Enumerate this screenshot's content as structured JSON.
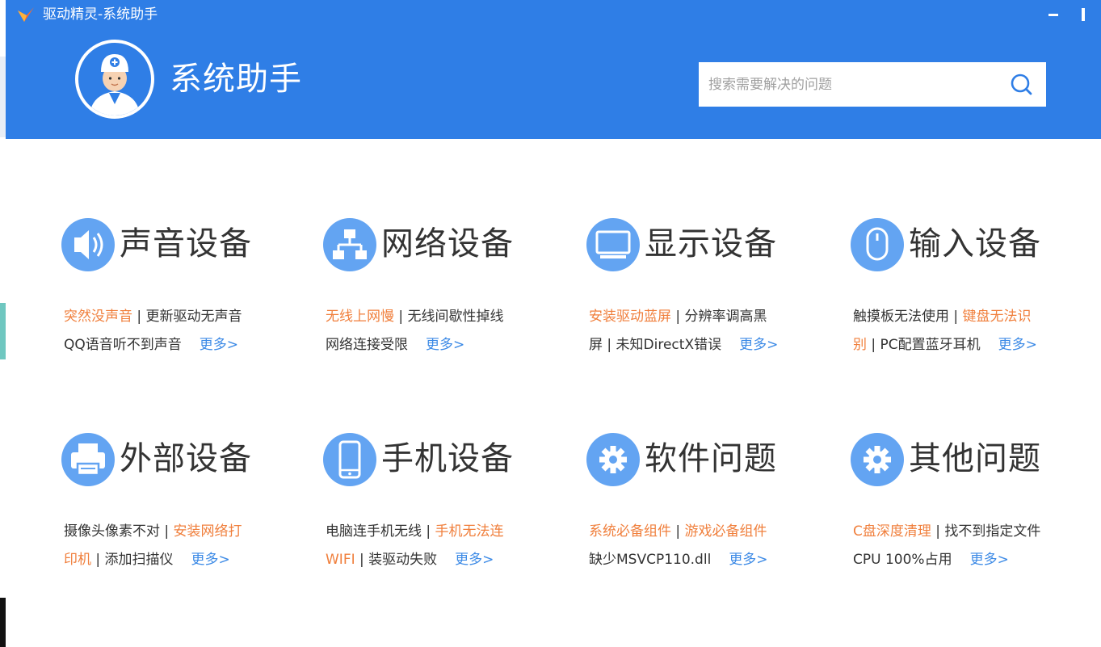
{
  "window": {
    "title": "驱动精灵-系统助手"
  },
  "header": {
    "brand_title": "系统助手",
    "search": {
      "placeholder": "搜索需要解决的问题"
    }
  },
  "colors": {
    "header_bg": "#2f7ee6",
    "icon_circle": "#63a4f2",
    "highlight_link": "#f07f3c",
    "more_link": "#3c8ae6",
    "text": "#333333"
  },
  "more_label": "更多>",
  "categories": [
    {
      "title": "声音设备",
      "icon": "speaker-icon",
      "lines": [
        [
          {
            "text": "突然没声音",
            "style": "hl"
          },
          {
            "text": " | ",
            "style": "sep"
          },
          {
            "text": "更新驱动无声音",
            "style": "nm"
          }
        ],
        [
          {
            "text": "QQ语音听不到声音",
            "style": "nm"
          }
        ]
      ]
    },
    {
      "title": "网络设备",
      "icon": "network-icon",
      "lines": [
        [
          {
            "text": "无线上网慢",
            "style": "hl"
          },
          {
            "text": " | ",
            "style": "sep"
          },
          {
            "text": "无线间歇性掉线",
            "style": "nm"
          }
        ],
        [
          {
            "text": "网络连接受限",
            "style": "nm"
          }
        ]
      ]
    },
    {
      "title": "显示设备",
      "icon": "monitor-icon",
      "lines": [
        [
          {
            "text": "安装驱动蓝屏",
            "style": "hl"
          },
          {
            "text": " | ",
            "style": "sep"
          },
          {
            "text": "分辨率调高黑",
            "style": "nm"
          }
        ],
        [
          {
            "text": "屏",
            "style": "nm"
          },
          {
            "text": " | ",
            "style": "sep"
          },
          {
            "text": "未知DirectX错误",
            "style": "nm"
          }
        ]
      ]
    },
    {
      "title": "输入设备",
      "icon": "mouse-icon",
      "lines": [
        [
          {
            "text": "触摸板无法使用",
            "style": "nm"
          },
          {
            "text": " | ",
            "style": "sep"
          },
          {
            "text": "键盘无法识",
            "style": "hl"
          }
        ],
        [
          {
            "text": "别",
            "style": "hl"
          },
          {
            "text": " | ",
            "style": "sep"
          },
          {
            "text": "PC配置蓝牙耳机",
            "style": "nm"
          }
        ]
      ]
    },
    {
      "title": "外部设备",
      "icon": "printer-icon",
      "lines": [
        [
          {
            "text": "摄像头像素不对",
            "style": "nm"
          },
          {
            "text": " | ",
            "style": "sep"
          },
          {
            "text": "安装网络打",
            "style": "hl"
          }
        ],
        [
          {
            "text": "印机",
            "style": "hl"
          },
          {
            "text": " | ",
            "style": "sep"
          },
          {
            "text": "添加扫描仪",
            "style": "nm"
          }
        ]
      ]
    },
    {
      "title": "手机设备",
      "icon": "phone-icon",
      "lines": [
        [
          {
            "text": "电脑连手机无线",
            "style": "nm"
          },
          {
            "text": " | ",
            "style": "sep"
          },
          {
            "text": "手机无法连",
            "style": "hl"
          }
        ],
        [
          {
            "text": "WIFI",
            "style": "hl"
          },
          {
            "text": " | ",
            "style": "sep"
          },
          {
            "text": "装驱动失败",
            "style": "nm"
          }
        ]
      ]
    },
    {
      "title": "软件问题",
      "icon": "gear-icon",
      "lines": [
        [
          {
            "text": "系统必备组件",
            "style": "hl"
          },
          {
            "text": " | ",
            "style": "sep"
          },
          {
            "text": "游戏必备组件",
            "style": "hl"
          }
        ],
        [
          {
            "text": "缺少MSVCP110.dll",
            "style": "nm"
          }
        ]
      ]
    },
    {
      "title": "其他问题",
      "icon": "gear-icon",
      "lines": [
        [
          {
            "text": "C盘深度清理",
            "style": "hl"
          },
          {
            "text": " | ",
            "style": "sep"
          },
          {
            "text": "找不到指定文件",
            "style": "nm"
          }
        ],
        [
          {
            "text": "CPU 100%占用",
            "style": "nm"
          }
        ]
      ]
    }
  ]
}
